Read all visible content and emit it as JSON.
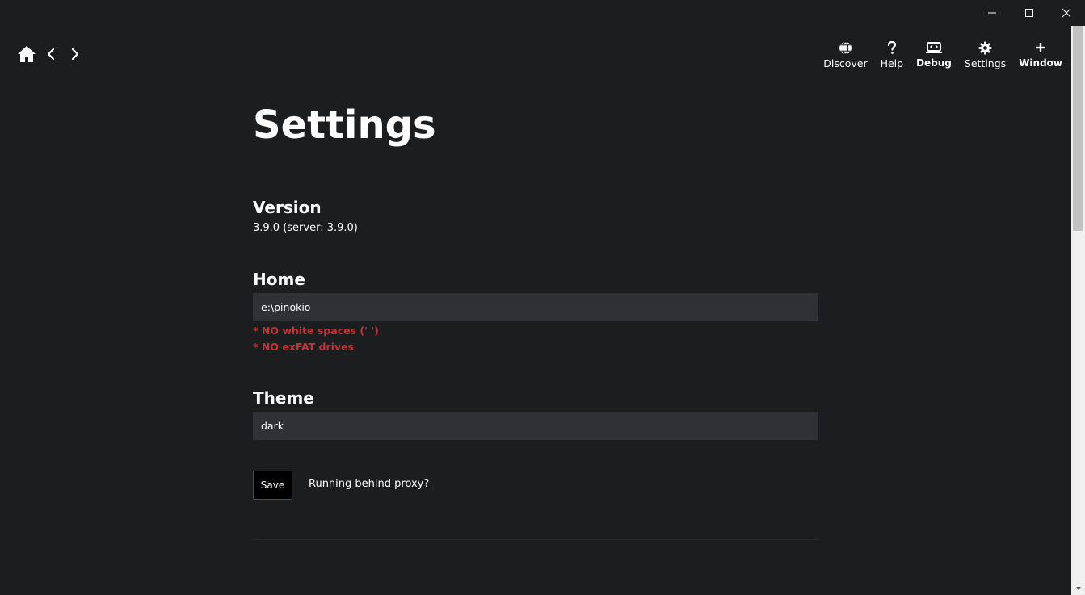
{
  "window_controls": {
    "minimize": "minimize-icon",
    "maximize": "maximize-icon",
    "close": "close-icon"
  },
  "nav": {
    "home_icon": "home-icon",
    "back_icon": "chevron-left-icon",
    "forward_icon": "chevron-right-icon"
  },
  "menu": {
    "items": [
      {
        "label": "Discover",
        "icon": "globe-icon"
      },
      {
        "label": "Help",
        "icon": "question-icon"
      },
      {
        "label": "Debug",
        "icon": "debug-icon"
      },
      {
        "label": "Settings",
        "icon": "gear-icon"
      },
      {
        "label": "Window",
        "icon": "plus-icon"
      }
    ]
  },
  "page": {
    "title": "Settings",
    "version": {
      "heading": "Version",
      "value": "3.9.0 (server: 3.9.0)"
    },
    "home": {
      "heading": "Home",
      "value": "e:\\pinokio",
      "warnings": [
        "* NO white spaces (' ')",
        "* NO exFAT drives"
      ]
    },
    "theme": {
      "heading": "Theme",
      "value": "dark"
    },
    "save_label": "Save",
    "proxy_link": "Running behind proxy?"
  },
  "colors": {
    "background": "#1c1d1f",
    "input_bg": "#303134",
    "warning": "#c0353a",
    "text": "#ffffff"
  }
}
